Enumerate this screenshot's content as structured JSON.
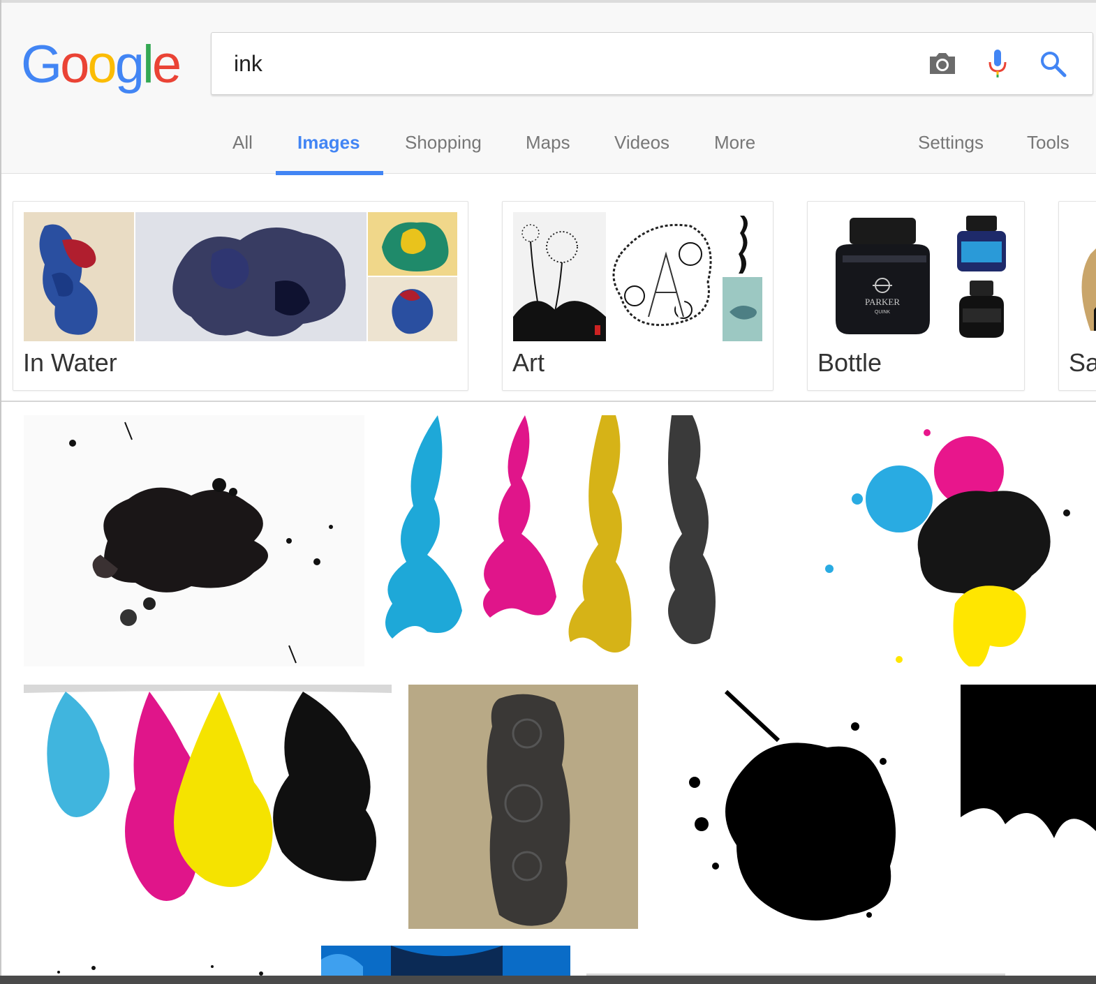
{
  "logo": {
    "letters": [
      "G",
      "o",
      "o",
      "g",
      "l",
      "e"
    ],
    "colors": [
      "#4285f4",
      "#ea4335",
      "#fbbc05",
      "#4285f4",
      "#34a853",
      "#ea4335"
    ]
  },
  "search": {
    "query": "ink"
  },
  "tabs": {
    "all": "All",
    "images": "Images",
    "shopping": "Shopping",
    "maps": "Maps",
    "videos": "Videos",
    "more": "More",
    "settings": "Settings",
    "tools": "Tools"
  },
  "related": {
    "in_water": "In Water",
    "art": "Art",
    "bottle": "Bottle",
    "partial": "Sa"
  },
  "bottle_label": {
    "brand": "PARKER",
    "product": "QUINK"
  },
  "colors": {
    "accent": "#4285f4",
    "tab_text": "#777777",
    "cyan": "#1ea8d8",
    "magenta": "#e0158a",
    "yellow": "#f2d600",
    "ink_black": "#141414"
  }
}
